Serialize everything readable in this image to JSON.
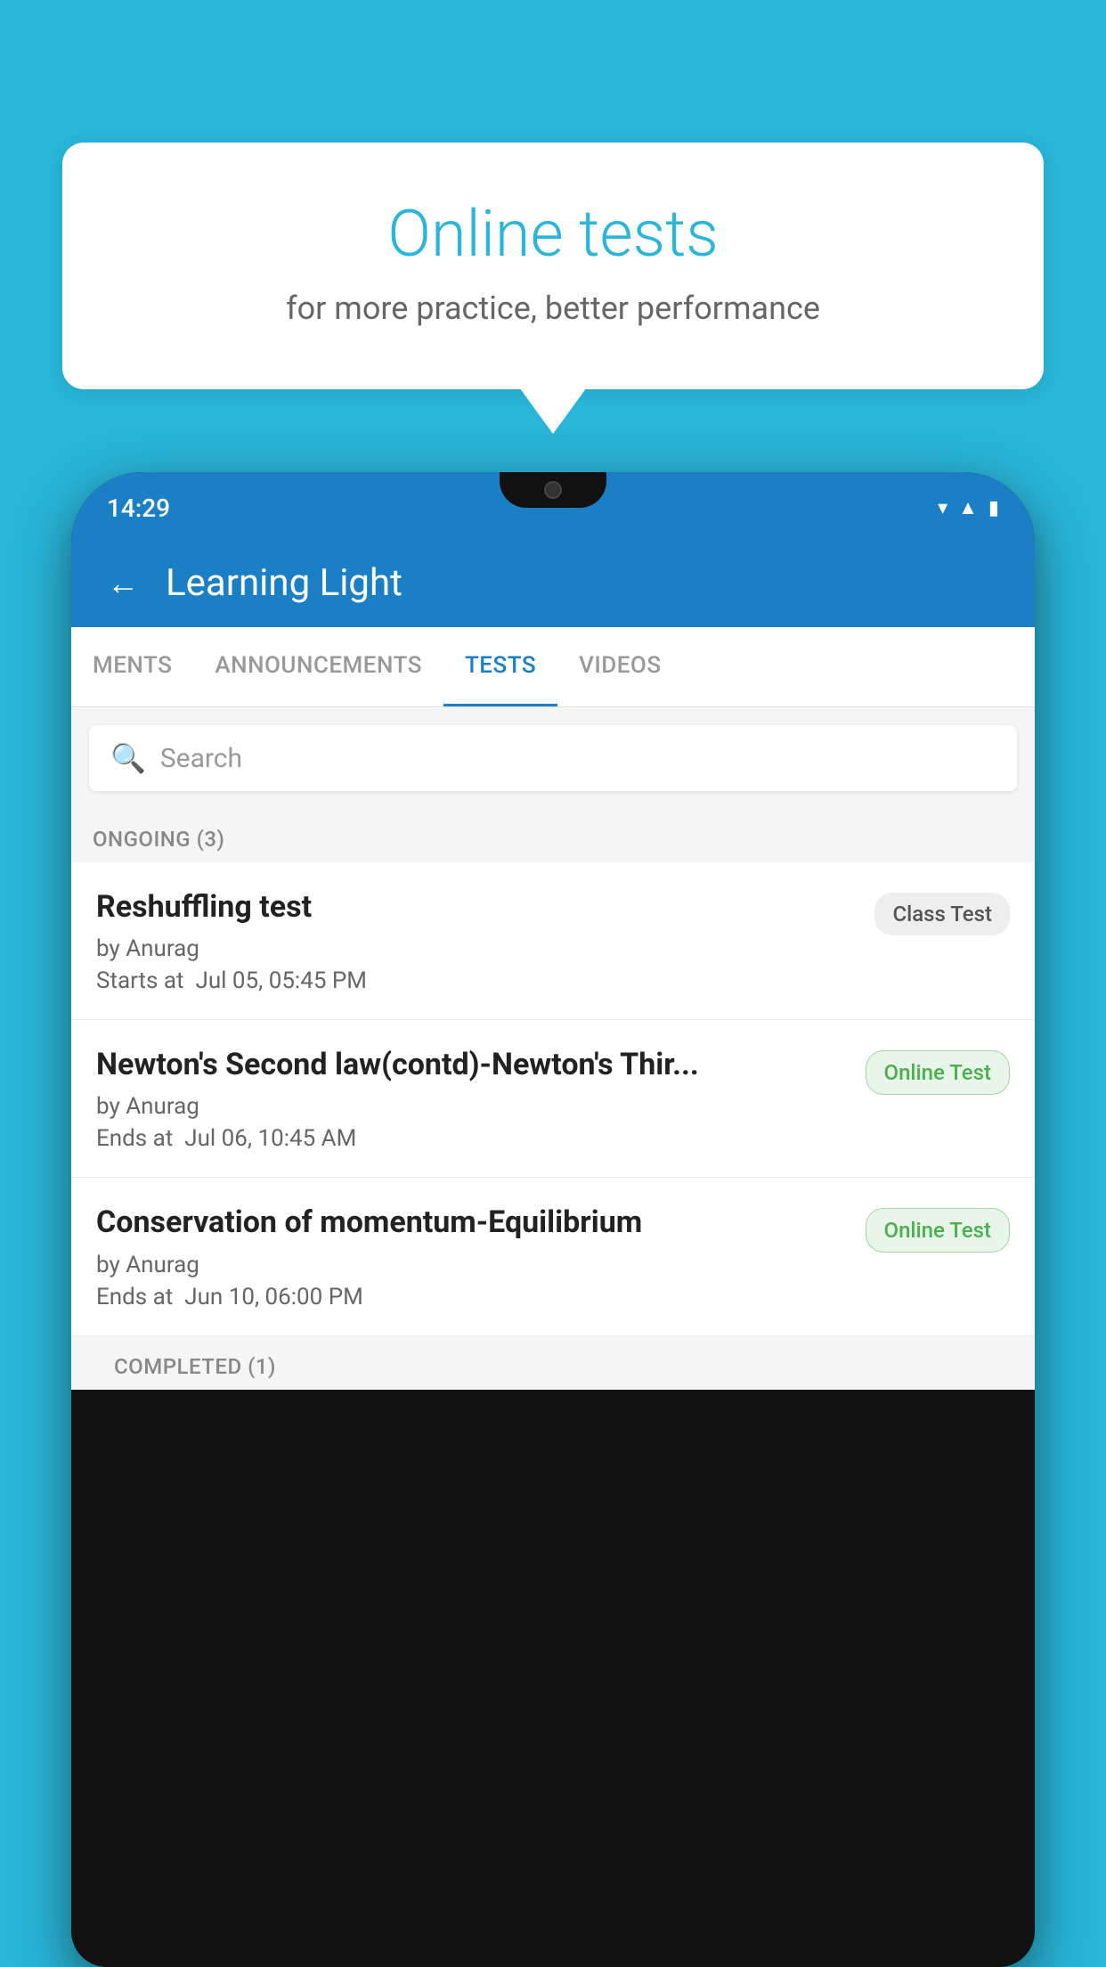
{
  "background": {
    "color": "#29b6d8"
  },
  "speech_bubble": {
    "title": "Online tests",
    "subtitle": "for more practice, better performance"
  },
  "phone": {
    "status_bar": {
      "time": "14:29",
      "icons": [
        "wifi",
        "signal",
        "battery"
      ]
    },
    "header": {
      "title": "Learning Light",
      "back_label": "←"
    },
    "tabs": [
      {
        "label": "MENTS",
        "active": false
      },
      {
        "label": "ANNOUNCEMENTS",
        "active": false
      },
      {
        "label": "TESTS",
        "active": true
      },
      {
        "label": "VIDEOS",
        "active": false
      }
    ],
    "search": {
      "placeholder": "Search"
    },
    "ongoing_section": {
      "label": "ONGOING (3)",
      "items": [
        {
          "name": "Reshuffling test",
          "by": "by Anurag",
          "time_label": "Starts at",
          "time": "Jul 05, 05:45 PM",
          "tag": "Class Test",
          "tag_type": "class"
        },
        {
          "name": "Newton's Second law(contd)-Newton's Thir...",
          "by": "by Anurag",
          "time_label": "Ends at",
          "time": "Jul 06, 10:45 AM",
          "tag": "Online Test",
          "tag_type": "online"
        },
        {
          "name": "Conservation of momentum-Equilibrium",
          "by": "by Anurag",
          "time_label": "Ends at",
          "time": "Jun 10, 06:00 PM",
          "tag": "Online Test",
          "tag_type": "online"
        }
      ]
    },
    "completed_section": {
      "label": "COMPLETED (1)"
    }
  }
}
